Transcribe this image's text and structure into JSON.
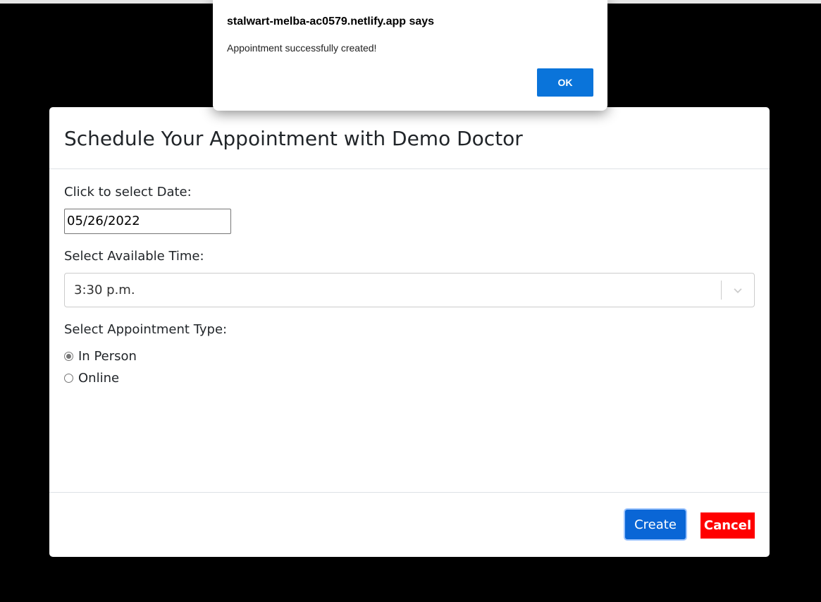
{
  "modal": {
    "title": "Schedule Your Appointment with Demo Doctor",
    "date_label": "Click to select Date:",
    "date_value": "05/26/2022",
    "time_label": "Select Available Time:",
    "time_value": "3:30 p.m.",
    "type_label": "Select Appointment Type:",
    "type_options": [
      {
        "label": "In Person",
        "checked": true
      },
      {
        "label": "Online",
        "checked": false
      }
    ],
    "create_label": "Create",
    "cancel_label": "Cancel"
  },
  "alert": {
    "title": "stalwart-melba-ac0579.netlify.app says",
    "message": "Appointment successfully created!",
    "ok_label": "OK"
  },
  "colors": {
    "create_button": "#0a66d6",
    "cancel_button": "#ff0000",
    "alert_ok_button": "#0a74da"
  }
}
